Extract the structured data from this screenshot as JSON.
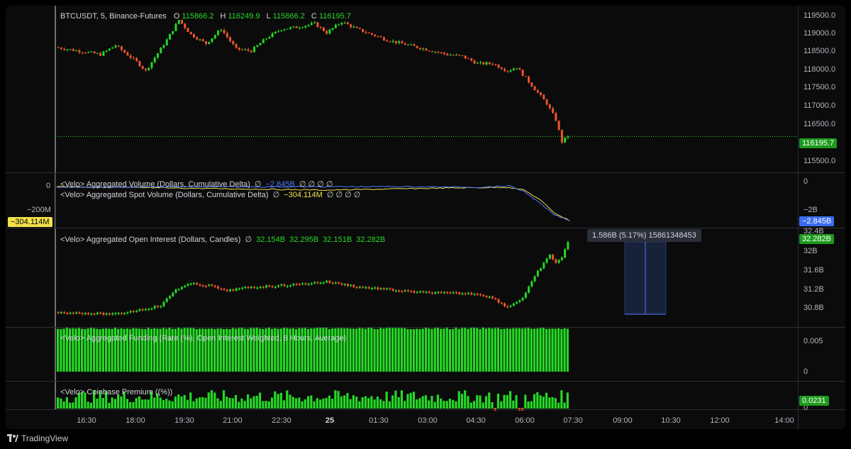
{
  "main": {
    "symbol": "BTCUSDT, 5, Binance-Futures",
    "ohlc": {
      "o_label": "O",
      "o": "115866.2",
      "h_label": "H",
      "h": "116249.9",
      "l_label": "L",
      "l": "115866.2",
      "c_label": "C",
      "c": "116195.7"
    },
    "price_axis": [
      "119500.0",
      "119000.0",
      "118500.0",
      "118000.0",
      "117500.0",
      "117000.0",
      "116500.0",
      "116000.0",
      "115500.0"
    ],
    "last_price_tag": "116195.7"
  },
  "volume_pane": {
    "line1": {
      "label": "<Velo> Aggregated Volume (Dollars, Cumulative Delta)",
      "value": "−2.845B",
      "icons": "∅ ∅ ∅ ∅"
    },
    "line2": {
      "label": "<Velo> Aggregated Spot Volume (Dollars, Cumulative Delta)",
      "value": "−304.114M",
      "icons": "∅ ∅ ∅ ∅"
    },
    "left_axis": [
      "0",
      "−200M"
    ],
    "left_tag": "−304.114M",
    "right_axis": [
      "0",
      "−2B"
    ],
    "right_tag": "−2.845B"
  },
  "oi_pane": {
    "label": "<Velo> Aggregated Open Interest (Dollars, Candles)",
    "values": [
      "32.154B",
      "32.295B",
      "32.151B",
      "32.282B"
    ],
    "axis": [
      "32.4B",
      "32B",
      "31.6B",
      "31.2B",
      "30.8B"
    ],
    "tag": "32.282B",
    "measure_tooltip": "1.586B (5.17%) 15861348453"
  },
  "funding_pane": {
    "label": "<Velo> Aggregated Funding (Rate (%), Open Interest Weighted, 8 Hours, Average)",
    "axis": [
      "0.005",
      "0"
    ]
  },
  "premium_pane": {
    "label": "<Velo> Coinbase Premium ((%))",
    "axis": [
      "0"
    ],
    "tag": "0.0231"
  },
  "time_axis": [
    "16:30",
    "18:00",
    "19:30",
    "21:00",
    "22:30",
    "25",
    "01:30",
    "03:00",
    "04:30",
    "06:00",
    "07:30",
    "09:00",
    "10:30",
    "12:00",
    "14:00"
  ],
  "footer": {
    "brand": "TradingView"
  },
  "colors": {
    "up": "#26d926",
    "down": "#f0552f",
    "volume": "#4f7cff",
    "spot": "#f2e14a",
    "bg": "#0b0b0b"
  }
}
